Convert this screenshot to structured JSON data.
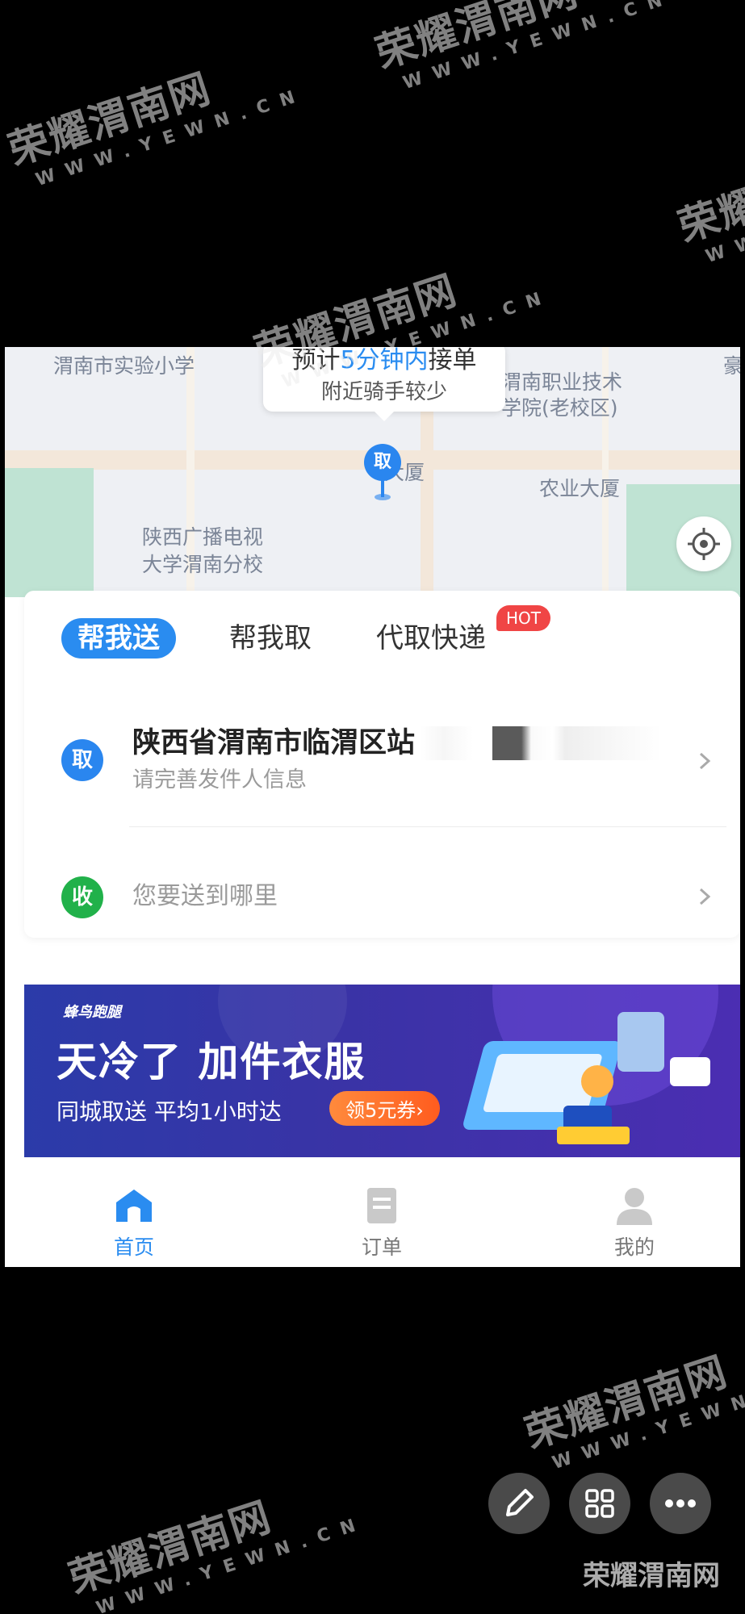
{
  "watermark": {
    "text": "荣耀渭南网",
    "url": "WWW.YEWN.CN"
  },
  "map": {
    "labels": [
      "渭南市实验小学",
      "渭南职业技术",
      "学院(老校区)",
      "大厦",
      "农业大厦",
      "陕西广播电视",
      "大学渭南分校",
      "豪"
    ],
    "eta_prefix": "预计",
    "eta_highlight": "5分钟内",
    "eta_suffix": "接单",
    "eta_sub": "附近骑手较少",
    "pin_label": "取"
  },
  "tabs": [
    {
      "label": "帮我送",
      "active": true
    },
    {
      "label": "帮我取",
      "active": false
    },
    {
      "label": "代取快递",
      "active": false
    }
  ],
  "hot_badge": "HOT",
  "pickup": {
    "badge": "取",
    "address": "陕西省渭南市临渭区站",
    "sub": "请完善发件人信息"
  },
  "delivery": {
    "badge": "收",
    "placeholder": "您要送到哪里"
  },
  "banner": {
    "brand": "蜂鸟跑腿",
    "title": "天冷了 加件衣服",
    "subtitle": "同城取送 平均1小时达",
    "coupon": "领5元券›"
  },
  "tabbar": [
    {
      "label": "首页",
      "icon": "home-icon",
      "active": true
    },
    {
      "label": "订单",
      "icon": "order-icon",
      "active": false
    },
    {
      "label": "我的",
      "icon": "profile-icon",
      "active": false
    }
  ],
  "colors": {
    "accent": "#2a8cf0",
    "green": "#21b14a",
    "hot": "#f04545"
  }
}
